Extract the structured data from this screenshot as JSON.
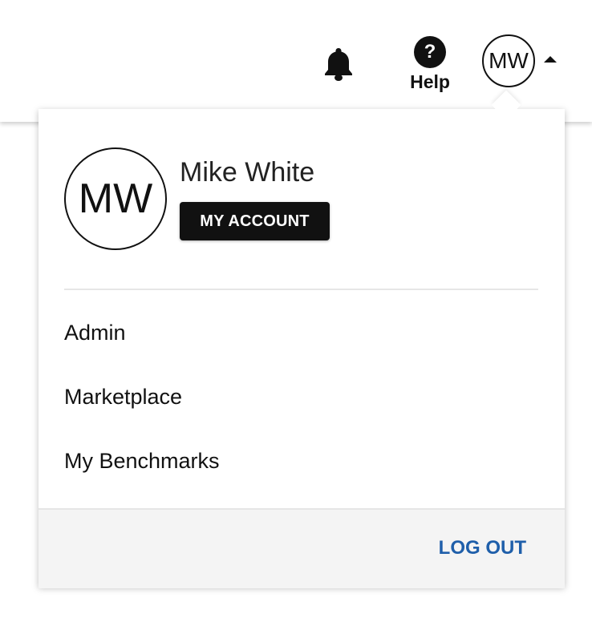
{
  "header": {
    "notifications_icon": "bell-icon",
    "help_icon": "question-circle-icon",
    "help_symbol": "?",
    "help_label": "Help",
    "user_initials": "MW",
    "menu_toggle_icon": "caret-up-icon"
  },
  "user_menu": {
    "avatar_initials": "MW",
    "user_name": "Mike White",
    "my_account_label": "MY ACCOUNT",
    "items": [
      {
        "label": "Admin"
      },
      {
        "label": "Marketplace"
      },
      {
        "label": "My Benchmarks"
      }
    ],
    "logout_label": "LOG OUT"
  },
  "colors": {
    "button_background": "#111111",
    "logout_link": "#1f5faa",
    "footer_background": "#f4f4f4"
  }
}
